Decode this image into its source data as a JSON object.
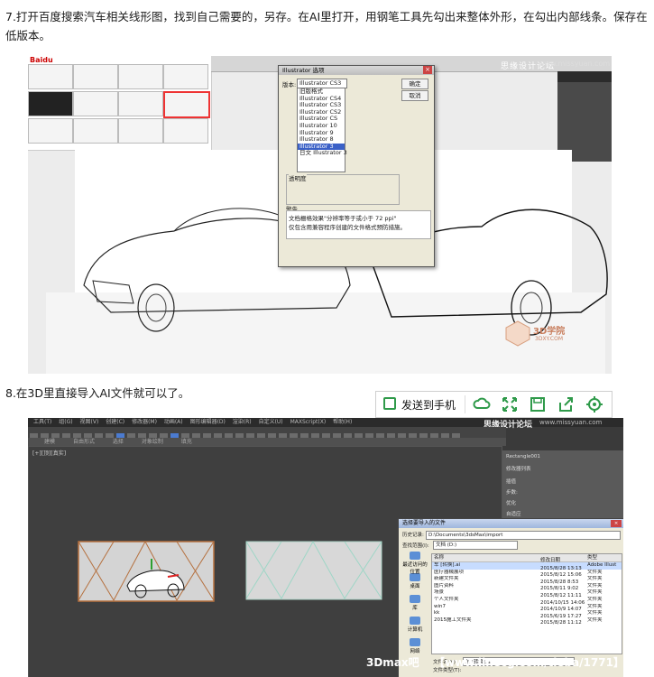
{
  "paragraphs": {
    "step7": "7.打开百度搜索汽车相关线形图，找到自己需要的，另存。在AI里打开，用钢笔工具先勾出来整体外形，在勾出内部线条。保存在低版本。",
    "step8": "8.在3D里直接导入AI文件就可以了。"
  },
  "share_bar": {
    "send_label": "发送到手机",
    "icons": [
      "send-to-phone-icon",
      "cloud-icon",
      "expand-icon",
      "save-icon",
      "share-icon",
      "settings-icon"
    ],
    "accent": "#2f9a4a"
  },
  "shot1": {
    "baidu_logo": "Baidu",
    "watermark": "思缘设计论坛",
    "watermark_url": "www.missyuan.com",
    "logo_3d": "3D学院",
    "logo_3d_url": "3DXY.COM",
    "dialog": {
      "title": "Illustrator 选项",
      "version_label": "版本:",
      "version_selected": "Illustrator CS3",
      "ok": "确定",
      "cancel": "取消",
      "versions": [
        "Illustrator CS3",
        "旧版格式",
        "Illustrator CS4",
        "Illustrator CS3",
        "Illustrator CS2",
        "Illustrator CS",
        "Illustrator 10",
        "Illustrator 9",
        "Illustrator 8",
        "Illustrator 3",
        "日文 Illustrator 3"
      ],
      "highlighted_index": 9,
      "transparency_label": "透明度",
      "warnings_label": "警告",
      "warnings": [
        "文档栅格效果\"分辨率等于或小于 72 ppi\"",
        "仅包含用兼容程序创建的文件格式预防措施。"
      ]
    }
  },
  "shot2": {
    "watermark": "思缘设计论坛",
    "watermark_url": "www.missyuan.com",
    "menu": [
      "工具(T)",
      "组(G)",
      "视图(V)",
      "创建(C)",
      "修改器(M)",
      "动画(A)",
      "图形编辑器(D)",
      "渲染(R)",
      "自定义(U)",
      "MAXScript(X)",
      "帮助(H)"
    ],
    "tabs": [
      "建模",
      "自由形式",
      "选择",
      "对象绘制",
      "填充"
    ],
    "viewport_label": "[+][顶][真实]",
    "cmd_rows": [
      "Rectangle001",
      "修改器列表",
      "插值",
      "步数:",
      "优化",
      "自适应",
      "渲染"
    ],
    "file_dialog": {
      "title": "选择要导入的文件",
      "history_label": "历史记录:",
      "address": "D:\\Documents\\3dsMax\\import",
      "lookin_label": "查找范围(I):",
      "lookin_value": "文档 (D:)",
      "columns": [
        "名称",
        "修改日期",
        "类型"
      ],
      "places": [
        "最近访问的位置",
        "桌面",
        "库",
        "计算机",
        "网络"
      ],
      "rows": [
        {
          "name": "车 [转换].ai",
          "date": "2015/8/28 13:13",
          "type": "Adobe Illust"
        },
        {
          "name": "医疗器械展项",
          "date": "2015/8/12 15:06",
          "type": "文件夹"
        },
        {
          "name": "新建文件夹",
          "date": "2015/8/28 8:53",
          "type": "文件夹"
        },
        {
          "name": "图片资料",
          "date": "2015/8/11 9:02",
          "type": "文件夹"
        },
        {
          "name": "场景",
          "date": "2015/8/12 11:11",
          "type": "文件夹"
        },
        {
          "name": "个人文件夹",
          "date": "2014/10/15 14:06",
          "type": "文件夹"
        },
        {
          "name": "win7",
          "date": "2014/10/9 14:07",
          "type": "文件夹"
        },
        {
          "name": "kk",
          "date": "2015/6/19 17:27",
          "type": "文件夹"
        },
        {
          "name": "2015施工文件夹",
          "date": "2015/8/28 11:12",
          "type": "文件夹"
        }
      ],
      "selected_index": 0,
      "filename_label": "文件名(N):",
      "filename_value": "车 [转换].ai",
      "filetype_label": "文件类型(T):"
    },
    "bottom_watermark_1": "3Dmax吧",
    "bottom_watermark_2": "【www.linecg.com/tieba/1771】"
  }
}
